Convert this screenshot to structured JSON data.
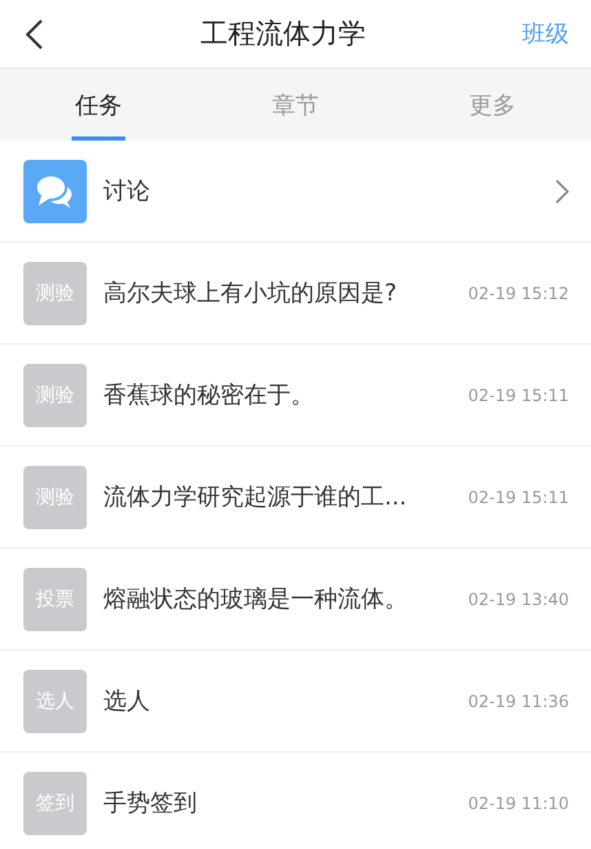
{
  "header": {
    "title": "工程流体力学",
    "action": "班级"
  },
  "tabs": [
    {
      "label": "任务",
      "selected": true
    },
    {
      "label": "章节",
      "selected": false
    },
    {
      "label": "更多",
      "selected": false
    }
  ],
  "discussion": {
    "label": "讨论"
  },
  "tasks": [
    {
      "badge": "测验",
      "title": "高尔夫球上有小坑的原因是?",
      "time": "02-19 15:12"
    },
    {
      "badge": "测验",
      "title": "香蕉球的秘密在于。",
      "time": "02-19 15:11"
    },
    {
      "badge": "测验",
      "title": "流体力学研究起源于谁的工...",
      "time": "02-19 15:11"
    },
    {
      "badge": "投票",
      "title": "熔融状态的玻璃是一种流体。",
      "time": "02-19 13:40"
    },
    {
      "badge": "选人",
      "title": "选人",
      "time": "02-19 11:36"
    },
    {
      "badge": "签到",
      "title": "手势签到",
      "time": "02-19 11:10"
    }
  ]
}
